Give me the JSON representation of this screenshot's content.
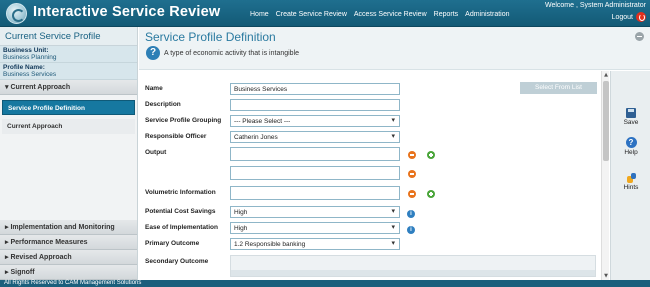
{
  "app": {
    "title": "Interactive Service Review"
  },
  "nav": [
    "Home",
    "Create Service Review",
    "Access Service Review",
    "Reports",
    "Administration"
  ],
  "user": {
    "welcome": "Welcome ,  System Administrator",
    "logout": "Logout"
  },
  "sidebar": {
    "title": "Current Service Profile",
    "business_unit_label": "Business Unit:",
    "business_unit_value": "Business Planning",
    "profile_name_label": "Profile Name:",
    "profile_name_value": "Business Services",
    "sections": {
      "current_approach": "Current Approach",
      "implementation": "Implementation and Monitoring",
      "performance": "Performance Measures",
      "revised": "Revised Approach",
      "signoff": "Signoff"
    },
    "active_item": "Service Profile Definition",
    "item": "Current Approach"
  },
  "page": {
    "title": "Service Profile Definition",
    "subtitle": "A type of economic activity that is intangible",
    "select_from_list": "Select From List"
  },
  "form": {
    "name_label": "Name",
    "name_value": "Business Services",
    "description_label": "Description",
    "description_value": "",
    "grouping_label": "Service Profile Grouping",
    "grouping_value": "--- Please Select ---",
    "officer_label": "Responsible Officer",
    "officer_value": "Catherin Jones",
    "output_label": "Output",
    "volumetric_label": "Volumetric Information",
    "cost_savings_label": "Potential Cost Savings",
    "cost_savings_value": "High",
    "ease_label": "Ease of Implementation",
    "ease_value": "High",
    "primary_label": "Primary Outcome",
    "primary_value": "1.2 Responsible banking",
    "secondary_label": "Secondary Outcome"
  },
  "tools": {
    "save": "Save",
    "help": "Help",
    "hints": "Hints"
  },
  "footer": {
    "text": "All Rights Reserved to CAM Management Solutions"
  },
  "icons": {
    "logo": "app-logo-icon",
    "power": "power-icon",
    "help": "help-icon",
    "minus": "remove-icon",
    "plus": "add-icon",
    "info": "info-icon",
    "save": "save-icon",
    "hints": "hints-icon",
    "collapse": "collapse-icon"
  },
  "colors": {
    "header": "#1f6f8f",
    "accent": "#1678a0",
    "minus": "#e8731c",
    "plus": "#4aa53a"
  }
}
